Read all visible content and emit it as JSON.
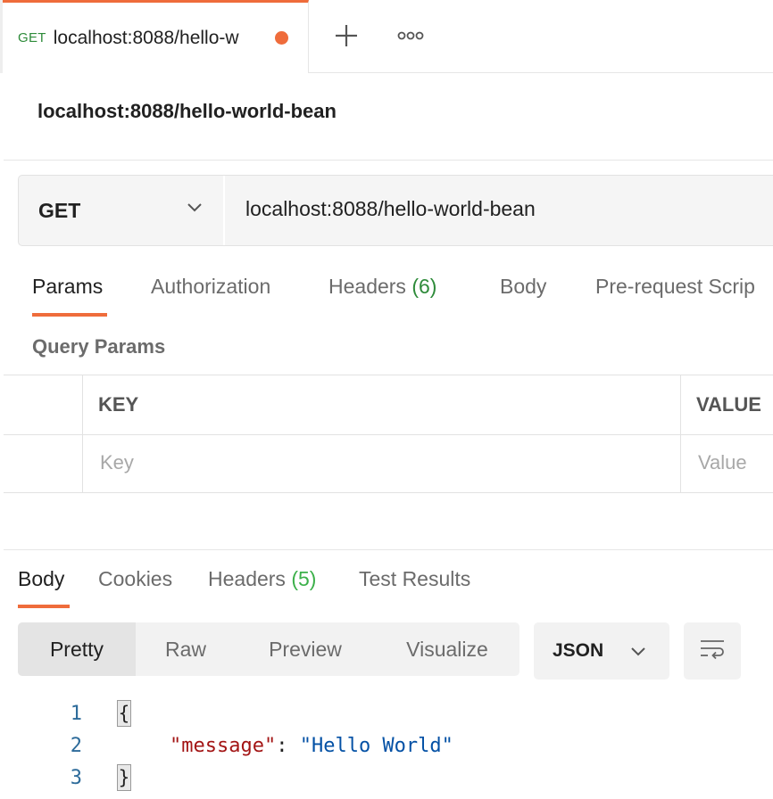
{
  "tab": {
    "method": "GET",
    "title": "localhost:8088/hello-w"
  },
  "request": {
    "title": "localhost:8088/hello-world-bean",
    "method": "GET",
    "url": "localhost:8088/hello-world-bean"
  },
  "request_tabs": [
    {
      "label": "Params"
    },
    {
      "label": "Authorization"
    },
    {
      "label": "Headers",
      "count": "(6)"
    },
    {
      "label": "Body"
    },
    {
      "label": "Pre-request Scrip"
    }
  ],
  "query_params": {
    "title": "Query Params",
    "col_key": "KEY",
    "col_value": "VALUE",
    "key_placeholder": "Key",
    "value_placeholder": "Value"
  },
  "response_tabs": [
    {
      "label": "Body"
    },
    {
      "label": "Cookies"
    },
    {
      "label": "Headers",
      "count": "(5)"
    },
    {
      "label": "Test Results"
    }
  ],
  "view_modes": [
    "Pretty",
    "Raw",
    "Preview",
    "Visualize"
  ],
  "format": "JSON",
  "code": {
    "line_numbers": [
      "1",
      "2",
      "3"
    ],
    "open_brace": "{",
    "key": "\"message\"",
    "colon": ": ",
    "value": "\"Hello World\"",
    "close_brace": "}"
  },
  "colors": {
    "accent": "#ef6c3b",
    "method_get": "#2e8b3a",
    "count_green": "#3cb04a"
  },
  "icons": [
    "plus-icon",
    "more-icon",
    "chevron-down-icon",
    "wrap-lines-icon"
  ]
}
